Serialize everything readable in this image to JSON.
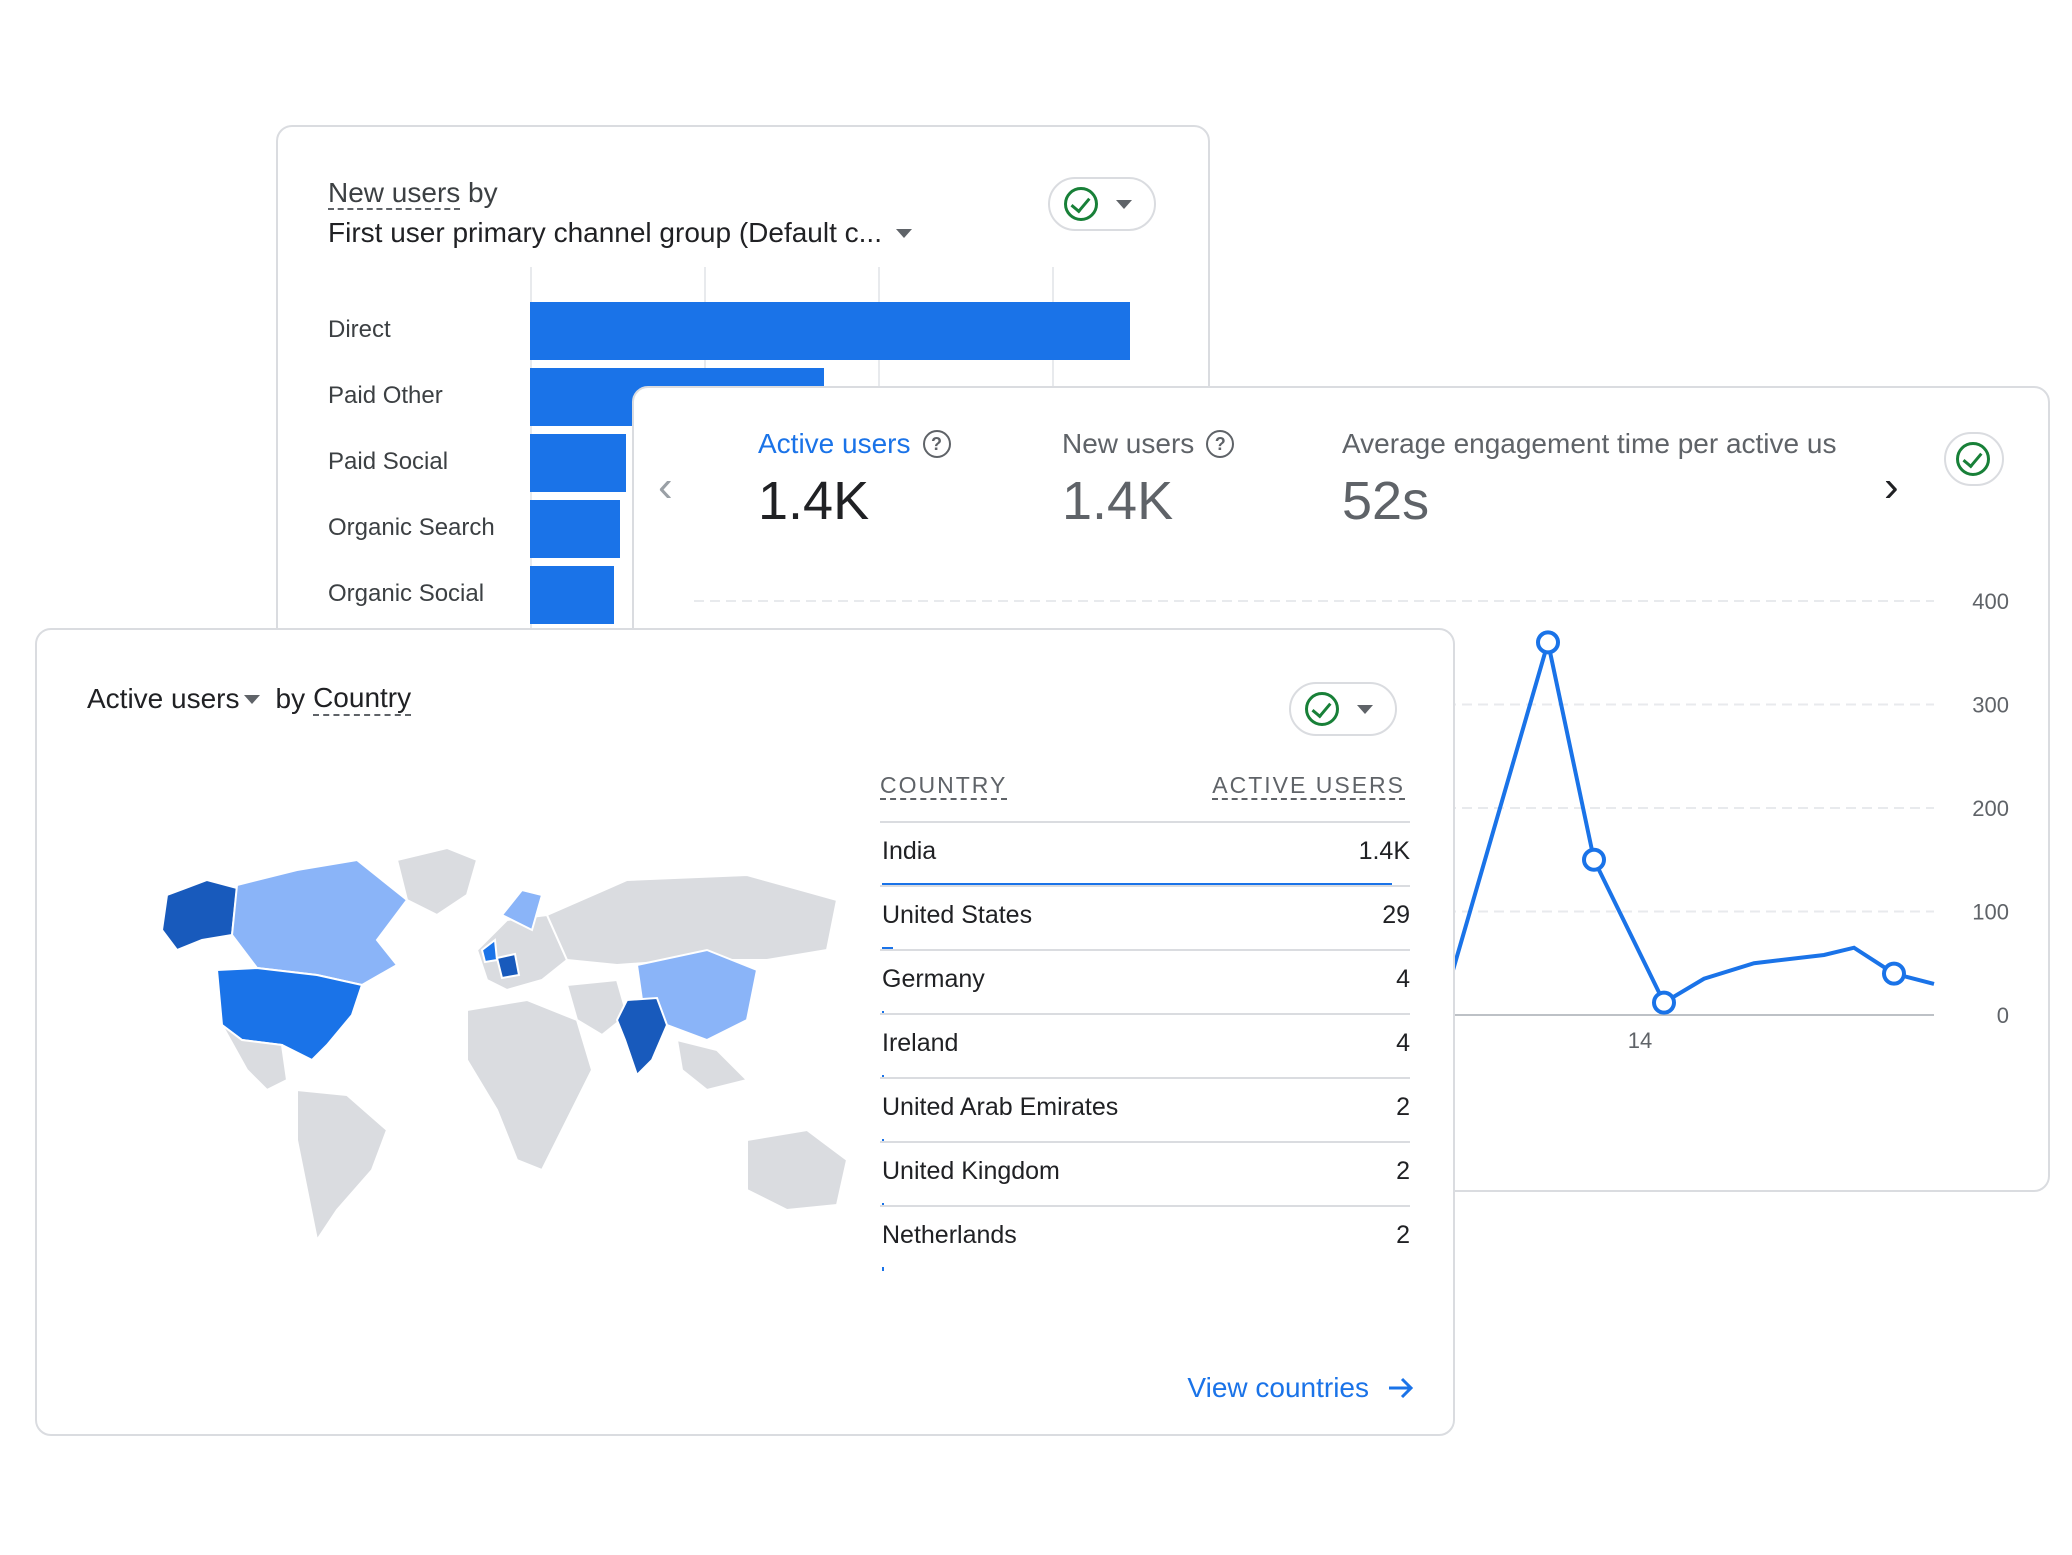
{
  "colors": {
    "accent": "#1a73e8",
    "success": "#188038",
    "map_dark": "#185abc",
    "map_mid": "#1a73e8",
    "map_light": "#8ab4f8",
    "map_none": "#dadce0"
  },
  "channel_card": {
    "title_metric": "New users",
    "title_by": "by",
    "dimension": "First user primary channel group (Default c...",
    "chart_data": {
      "type": "bar",
      "categories": [
        "Direct",
        "Paid Other",
        "Paid Social",
        "Organic Search",
        "Organic Social"
      ],
      "values": [
        100,
        49,
        16,
        15,
        14
      ],
      "value_scale_note": ""
    }
  },
  "metrics_card": {
    "metrics": [
      {
        "label": "Active users",
        "value": "1.4K"
      },
      {
        "label": "New users",
        "value": "1.4K"
      },
      {
        "label": "Average engagement time per active us",
        "value": "52s"
      }
    ],
    "chart_data": {
      "type": "line",
      "ylim": [
        0,
        400
      ],
      "yticks": [
        "400",
        "300",
        "200",
        "100",
        "0"
      ],
      "xtick_labels": [
        "14"
      ],
      "series": [
        {
          "values": [
            60,
            40,
            360,
            150,
            12,
            35,
            50,
            58,
            65,
            40,
            30
          ]
        }
      ]
    }
  },
  "country_card": {
    "title_metric": "Active users",
    "title_by": "by",
    "title_dimension": "Country",
    "col_country": "COUNTRY",
    "col_users": "ACTIVE USERS",
    "rows": [
      {
        "country": "India",
        "users": "1.4K",
        "share": 1.0
      },
      {
        "country": "United States",
        "users": "29",
        "share": 0.021
      },
      {
        "country": "Germany",
        "users": "4",
        "share": 0.003
      },
      {
        "country": "Ireland",
        "users": "4",
        "share": 0.003
      },
      {
        "country": "United Arab Emirates",
        "users": "2",
        "share": 0.0015
      },
      {
        "country": "United Kingdom",
        "users": "2",
        "share": 0.0015
      },
      {
        "country": "Netherlands",
        "users": "2",
        "share": 0.0015
      }
    ],
    "link": "View countries"
  }
}
